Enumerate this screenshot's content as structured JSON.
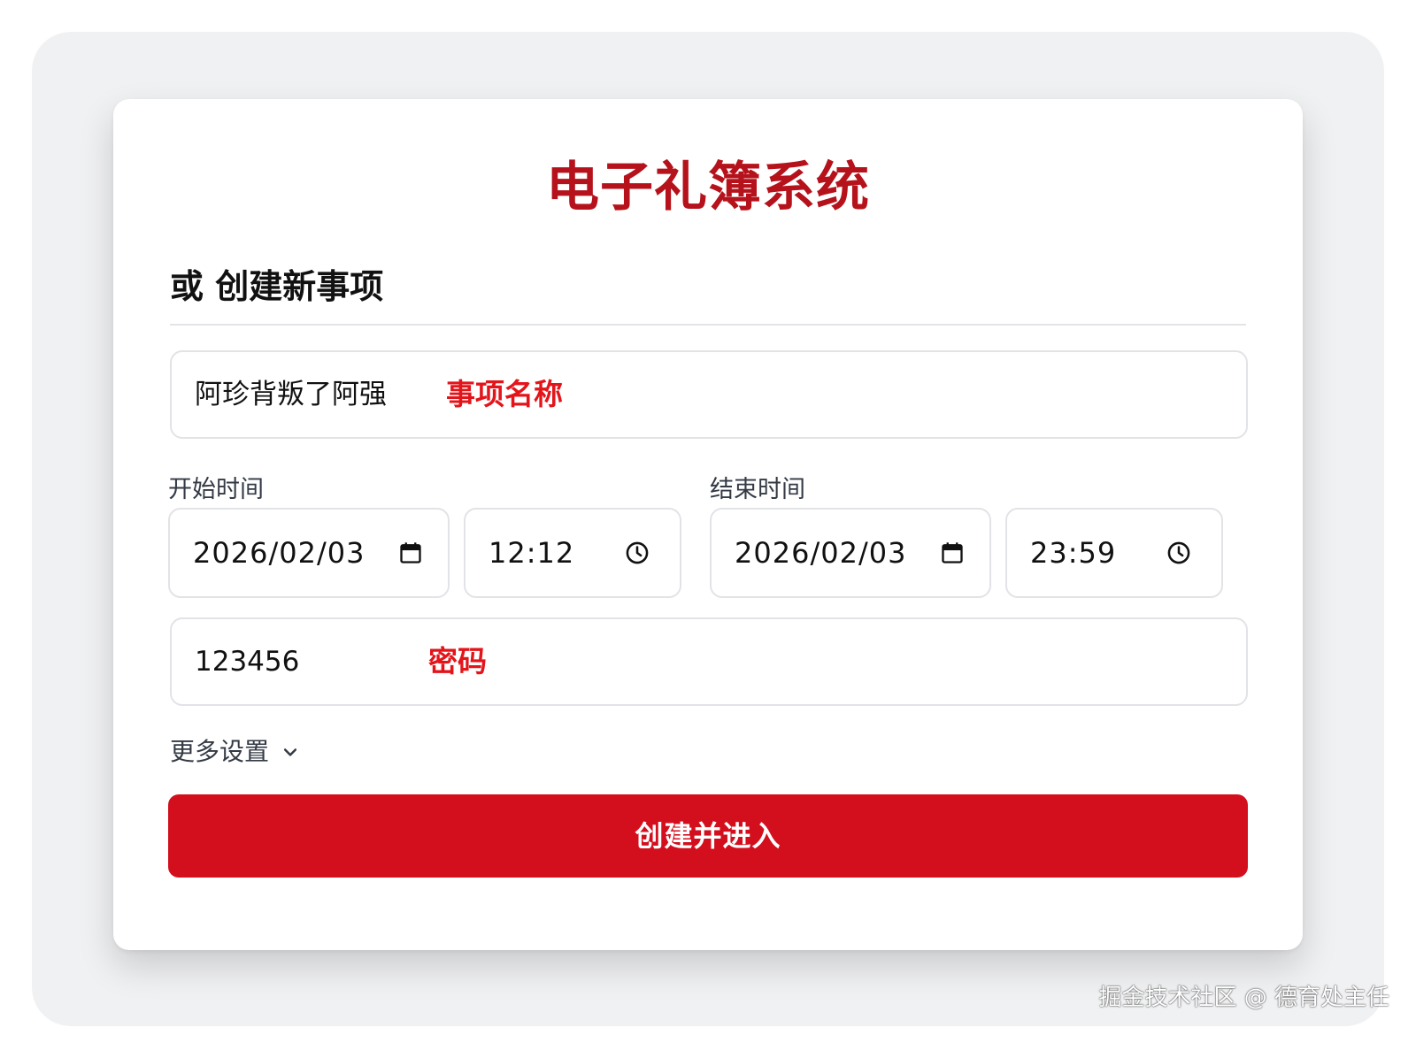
{
  "app_title": "电子礼簿系统",
  "section_title": "或 创建新事项",
  "event_name": {
    "value": "阿珍背叛了阿强",
    "annotation": "事项名称"
  },
  "start": {
    "label": "开始时间",
    "date": "2026/02/03",
    "time": "12:12"
  },
  "end": {
    "label": "结束时间",
    "date": "2026/02/03",
    "time": "23:59"
  },
  "password": {
    "value": "123456",
    "annotation": "密码"
  },
  "more_settings_label": "更多设置",
  "submit_label": "创建并进入",
  "watermark": "掘金技术社区 @ 德育处主任",
  "colors": {
    "brand_red": "#d30f1e",
    "title_red": "#b5121b",
    "annotation_red": "#e3151b"
  },
  "icons": [
    "calendar-icon",
    "clock-icon",
    "chevron-down-icon"
  ]
}
